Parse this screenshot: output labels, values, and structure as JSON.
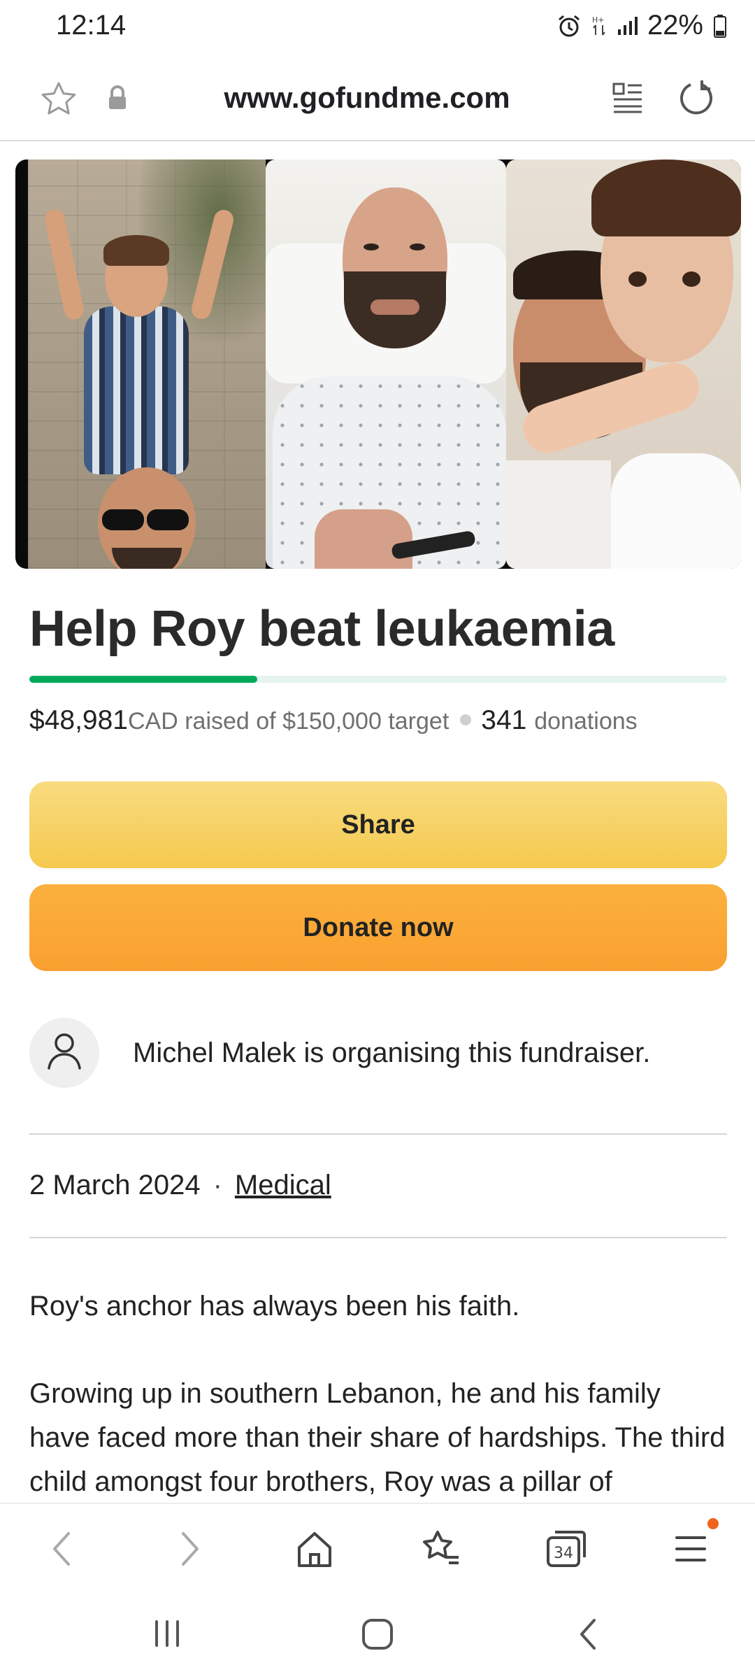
{
  "status_bar": {
    "time": "12:14",
    "battery": "22%"
  },
  "browser": {
    "url": "www.gofundme.com",
    "tab_count": "34"
  },
  "campaign": {
    "title": "Help Roy beat leukaemia",
    "progress_fraction": 0.327,
    "raised": "$48,981",
    "raised_suffix": "CAD raised of $150,000 target",
    "donations_count": "341",
    "donations_label": "donations",
    "share_label": "Share",
    "donate_label": "Donate now",
    "organiser_text": "Michel Malek is organising this fundraiser.",
    "date": "2 March 2024",
    "category": "Medical",
    "story": [
      "Roy's anchor has always been his faith.",
      "Growing up in southern Lebanon, he and his family have faced more than their share of hardships. The third child amongst four brothers, Roy was a pillar of"
    ]
  },
  "colors": {
    "progress": "#02a95c",
    "share_button": "#f5c94e",
    "donate_button": "#f9a02f",
    "notification_dot": "#f0641e"
  }
}
